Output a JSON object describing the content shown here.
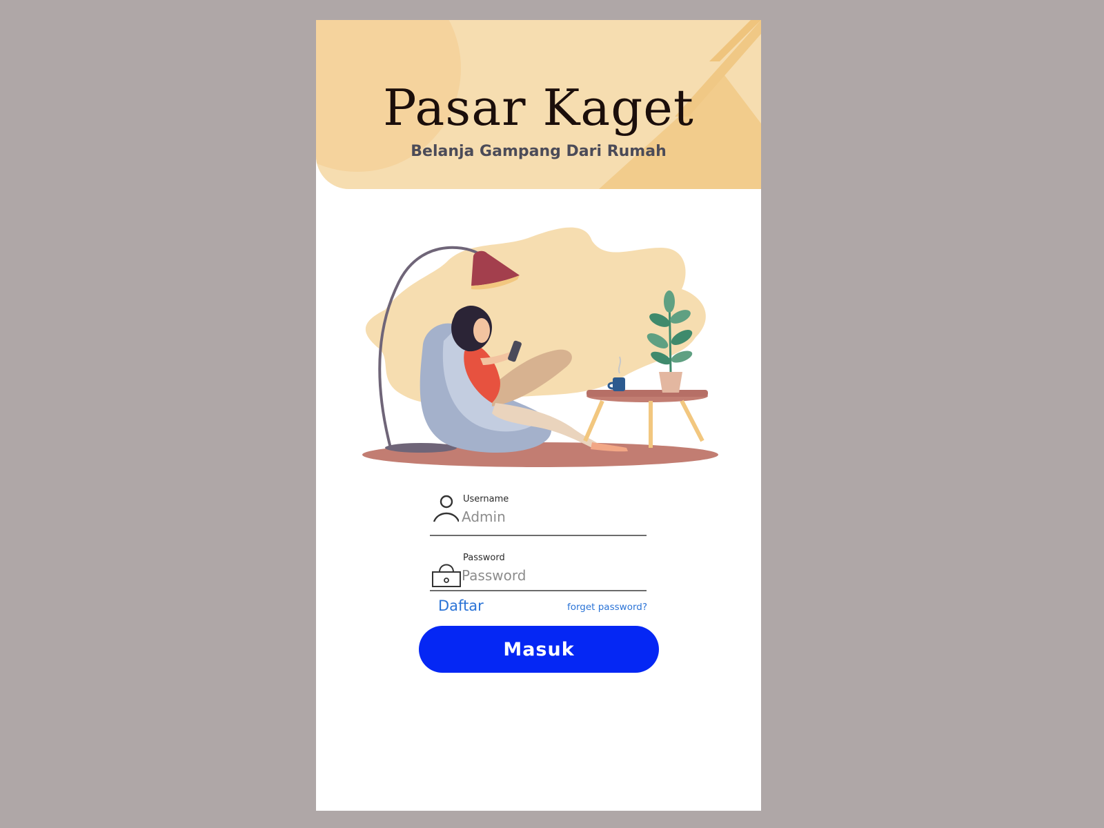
{
  "header": {
    "title": "Pasar Kaget",
    "tagline": "Belanja Gampang Dari Rumah"
  },
  "form": {
    "username": {
      "label": "Username",
      "placeholder": "Admin",
      "value": ""
    },
    "password": {
      "label": "Password",
      "placeholder": "Password",
      "value": ""
    },
    "register_link": "Daftar",
    "forgot_link": "forget password?",
    "submit_label": "Masuk"
  },
  "icons": {
    "username": "user-icon",
    "password": "lock-icon"
  },
  "colors": {
    "background": "#afa7a7",
    "header": "#f6ddb0",
    "accent": "#0527f4",
    "link": "#2a73d6"
  }
}
